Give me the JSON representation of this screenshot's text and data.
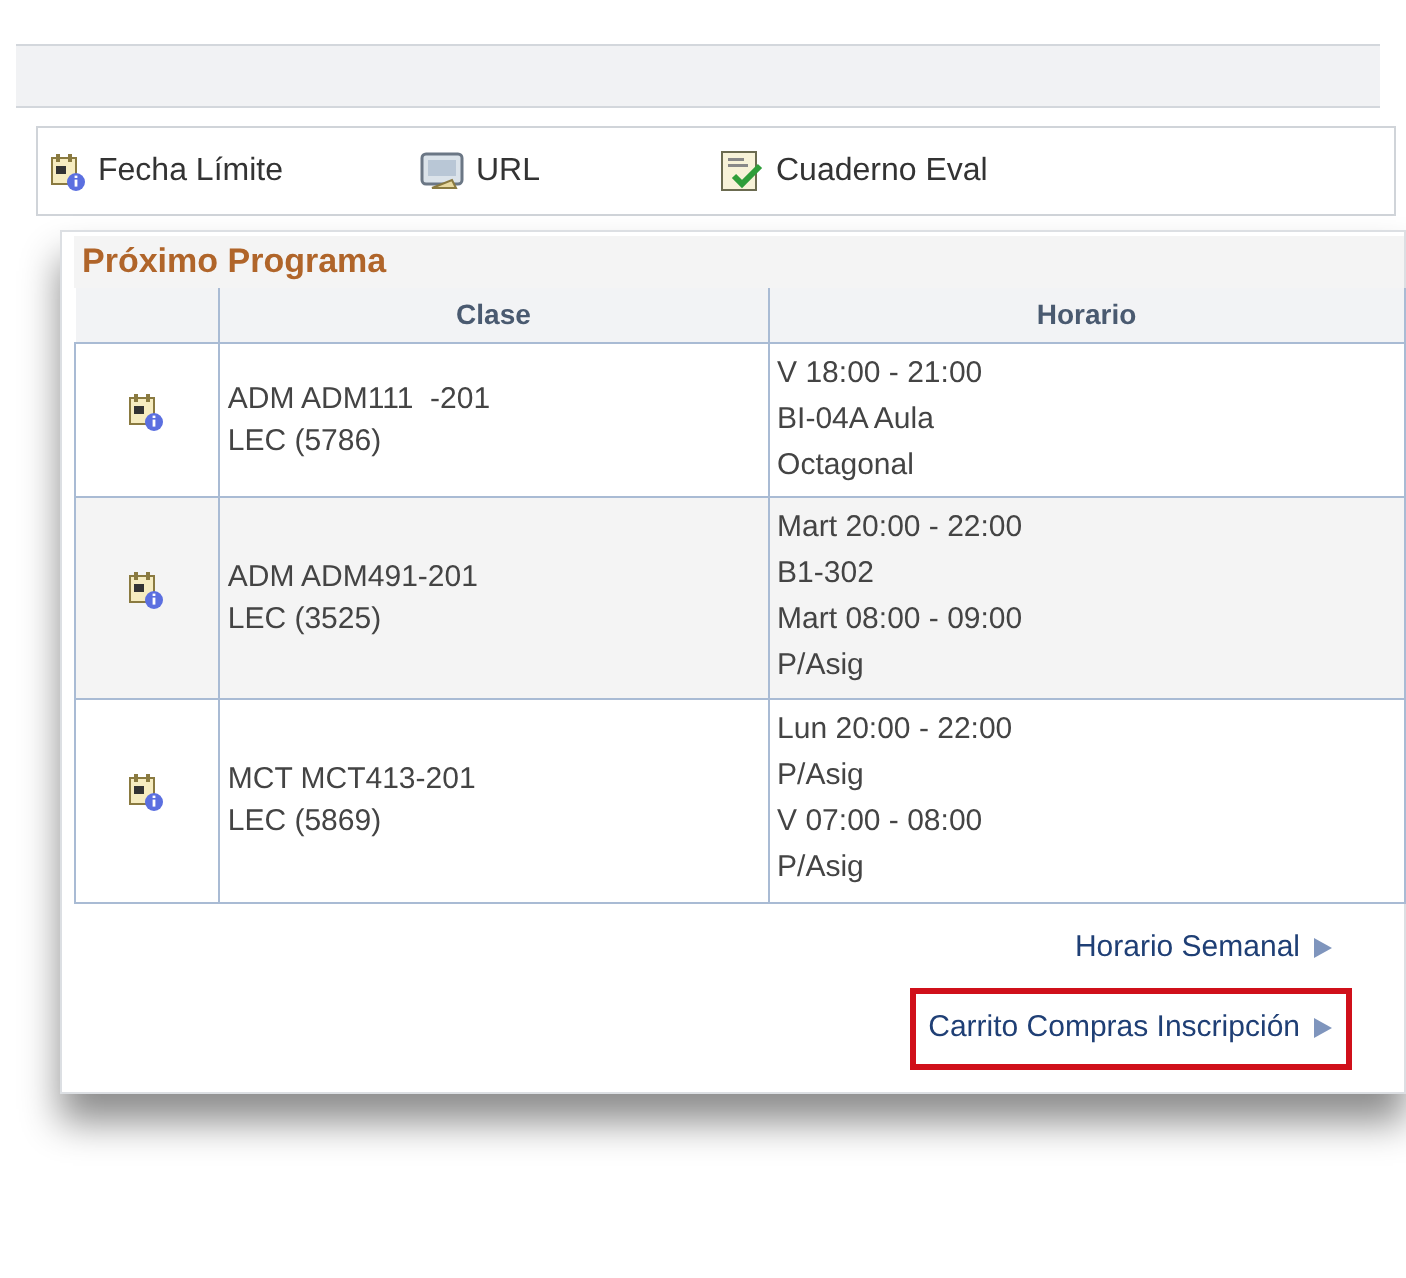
{
  "toolbar": [
    {
      "label": "Fecha Límite",
      "kind": "deadline"
    },
    {
      "label": "URL",
      "kind": "url"
    },
    {
      "label": "Cuaderno Eval",
      "kind": "gradebook"
    }
  ],
  "schedule": {
    "title": "Próximo Programa",
    "columns": [
      "Clase",
      "Horario"
    ],
    "rows": [
      {
        "clase": [
          "ADM ADM111  -201",
          "LEC (5786)"
        ],
        "horario": [
          "V 18:00 - 21:00",
          "BI-04A Aula",
          "Octagonal"
        ]
      },
      {
        "clase": [
          "ADM ADM491-201",
          "LEC (3525)"
        ],
        "horario": [
          "Mart 20:00 - 22:00",
          "B1-302",
          "Mart 08:00 - 09:00",
          "P/Asig"
        ]
      },
      {
        "clase": [
          "MCT MCT413-201",
          "LEC (5869)"
        ],
        "horario": [
          "Lun 20:00 - 22:00",
          "P/Asig",
          "V 07:00 - 08:00",
          "P/Asig"
        ]
      }
    ],
    "links": [
      {
        "label": "Horario Semanal",
        "highlighted": false
      },
      {
        "label": "Carrito Compras Inscripción",
        "highlighted": true
      }
    ]
  }
}
